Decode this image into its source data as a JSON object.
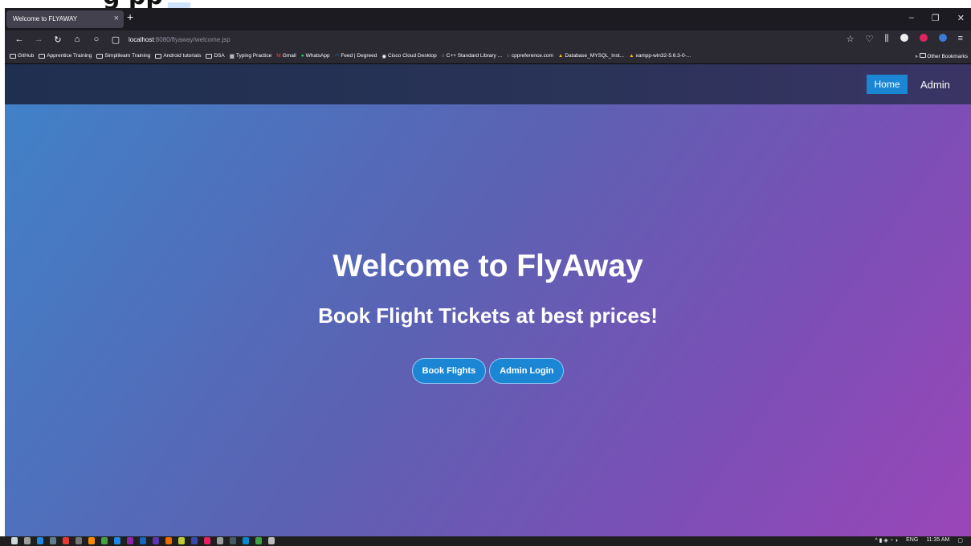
{
  "cropped_heading": "g      pp",
  "browser": {
    "tab_title": "Welcome to FLYAWAY",
    "url_host": "localhost",
    "url_rest": ":8080/flyaway/welcome.jsp",
    "bookmarks": [
      "GitHub",
      "Apprentice Training",
      "Simplilearn Training",
      "Android tutorials",
      "DSA",
      "Typing Practice",
      "Gmail",
      "WhatsApp",
      "Feed | Degreed",
      "Cisco Cloud Desktop",
      "C++ Standard Library ...",
      "cppreference.com",
      "Database_MYSQL_Inst...",
      "xampp-win32-5.6.3-0-..."
    ],
    "other_bookmarks": "Other Bookmarks"
  },
  "site": {
    "nav_home": "Home",
    "nav_admin": "Admin",
    "title": "Welcome to FlyAway",
    "subtitle": "Book Flight Tickets at best prices!",
    "btn_book": "Book Flights",
    "btn_admin": "Admin Login"
  },
  "taskbar": {
    "lang": "ENG",
    "time": "11:35 AM"
  },
  "colors": {
    "accent": "#1b87d4"
  }
}
